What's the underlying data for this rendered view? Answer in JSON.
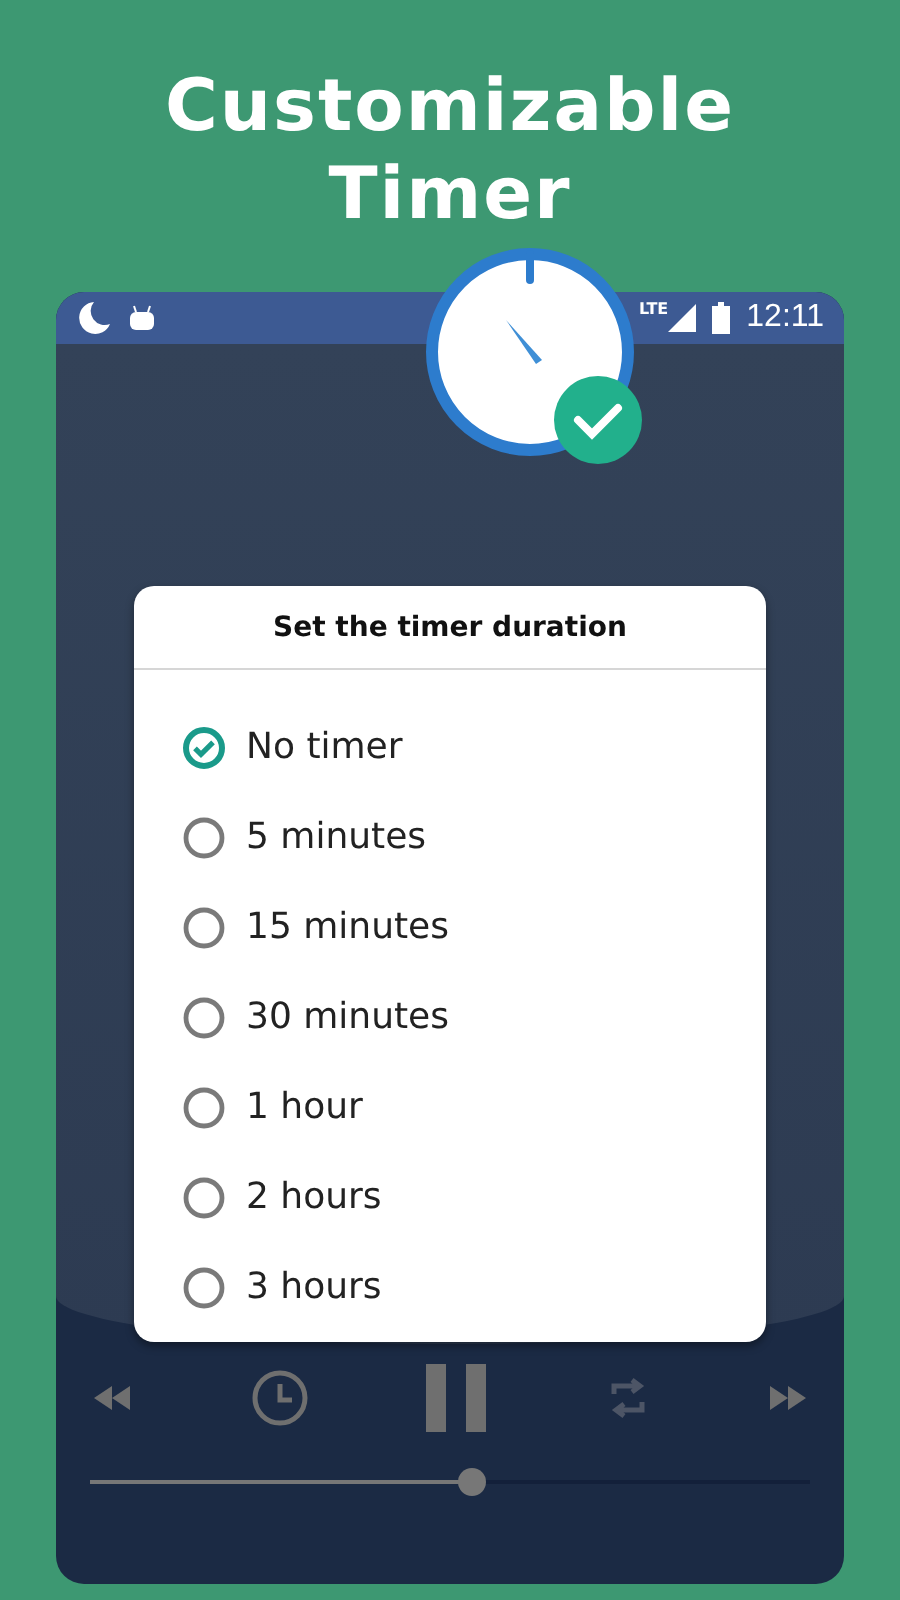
{
  "headline": "Customizable Timer",
  "status_bar": {
    "network": "LTE",
    "time": "12:11"
  },
  "dialog": {
    "title": "Set the timer duration",
    "options": [
      {
        "label": "No timer",
        "selected": true
      },
      {
        "label": "5 minutes",
        "selected": false
      },
      {
        "label": "15 minutes",
        "selected": false
      },
      {
        "label": "30 minutes",
        "selected": false
      },
      {
        "label": "1 hour",
        "selected": false
      },
      {
        "label": "2 hours",
        "selected": false
      },
      {
        "label": "3 hours",
        "selected": false
      }
    ]
  },
  "player": {
    "progress": {
      "level": 0.53
    }
  }
}
